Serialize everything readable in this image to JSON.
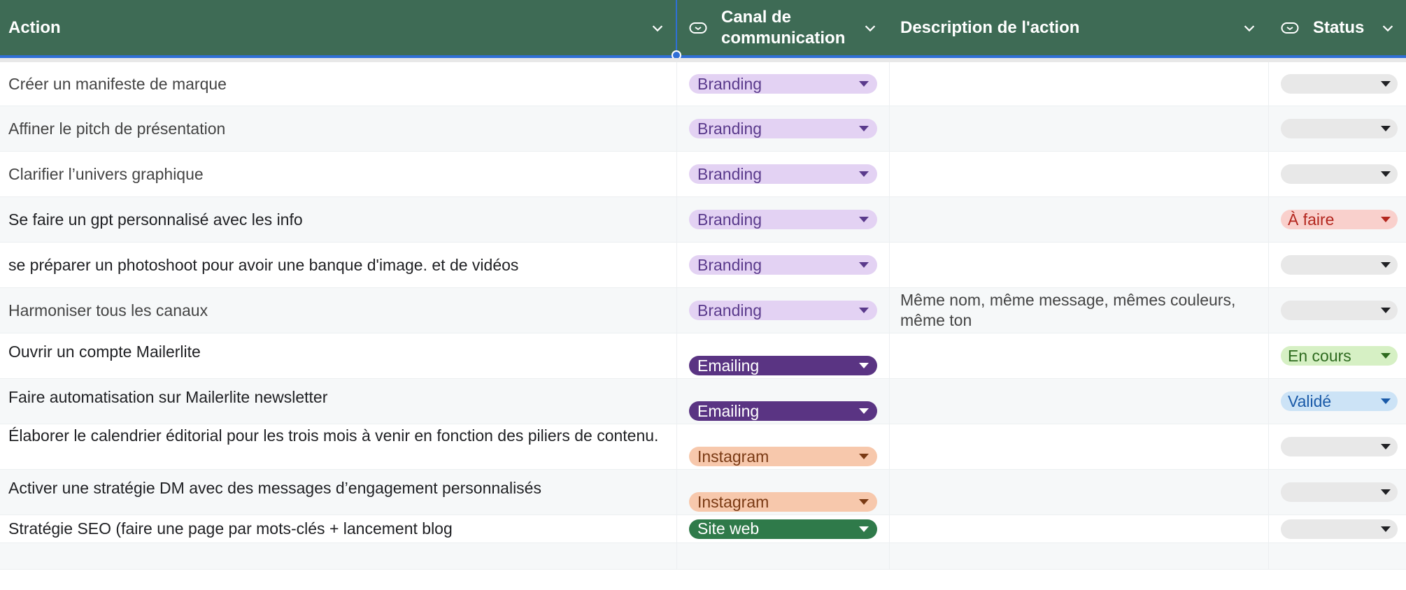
{
  "columns": {
    "action": "Action",
    "canal": "Canal de communication",
    "canal_line1": "Canal de",
    "canal_line2": "communication",
    "description": "Description de l'action",
    "status": "Status"
  },
  "colors": {
    "header_bg": "#3e6b55",
    "branding_bg": "#e3d2f3",
    "branding_fg": "#5a3a8c",
    "emailing_bg": "#5a3483",
    "emailing_fg": "#ffffff",
    "instagram_bg": "#f7c8ac",
    "instagram_fg": "#7a3a14",
    "siteweb_bg": "#2f7a4a",
    "siteweb_fg": "#ffffff",
    "afaire_bg": "#f9d0cc",
    "afaire_fg": "#b3261e",
    "encours_bg": "#d6f0c4",
    "encours_fg": "#2e6b1f",
    "valide_bg": "#cce3f6",
    "valide_fg": "#1a5aa8",
    "empty_bg": "#e8e8e8"
  },
  "rows": [
    {
      "action": "Créer un manifeste de marque",
      "canal": "Branding",
      "description": "",
      "status": ""
    },
    {
      "action": "Affiner le pitch de présentation",
      "canal": "Branding",
      "description": "",
      "status": ""
    },
    {
      "action": "Clarifier l’univers graphique",
      "canal": "Branding",
      "description": "",
      "status": ""
    },
    {
      "action": "Se faire un gpt personnalisé avec les info",
      "canal": "Branding",
      "description": "",
      "status": "À faire"
    },
    {
      "action": "se préparer un photoshoot pour avoir une banque d'image. et de vidéos",
      "canal": "Branding",
      "description": "",
      "status": ""
    },
    {
      "action": "Harmoniser tous les canaux",
      "canal": "Branding",
      "description": "Même nom, même message, mêmes couleurs, même ton",
      "status": ""
    },
    {
      "action": "Ouvrir un compte Mailerlite",
      "canal": "Emailing",
      "description": "",
      "status": "En cours"
    },
    {
      "action": "Faire automatisation sur Mailerlite newsletter",
      "canal": "Emailing",
      "description": "",
      "status": "Validé"
    },
    {
      "action": "Élaborer le calendrier éditorial pour les trois mois à venir en fonction des piliers de contenu.",
      "canal": "Instagram",
      "description": "",
      "status": ""
    },
    {
      "action": "Activer une stratégie DM avec des messages d’engagement personnalisés",
      "canal": "Instagram",
      "description": "",
      "status": ""
    },
    {
      "action": "Stratégie SEO (faire une page par mots-clés + lancement blog",
      "canal": "Site web",
      "description": "",
      "status": ""
    }
  ]
}
